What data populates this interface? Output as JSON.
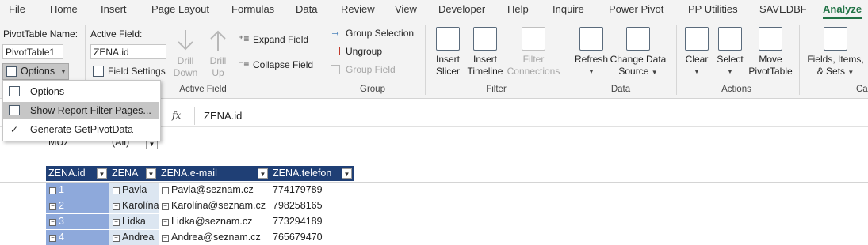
{
  "menu_tabs": [
    "File",
    "Home",
    "Insert",
    "Page Layout",
    "Formulas",
    "Data",
    "Review",
    "View",
    "Developer",
    "Help",
    "Inquire",
    "Power Pivot",
    "PP Utilities",
    "SAVEDBF",
    "Analyze"
  ],
  "pivot": {
    "name_label": "PivotTable Name:",
    "name_value": "PivotTable1",
    "options_label": "Options",
    "active_field_label": "Active Field:",
    "active_field_value": "ZENA.id",
    "field_settings": "Field Settings",
    "drill_down": [
      "Drill",
      "Down"
    ],
    "drill_up": [
      "Drill",
      "Up"
    ],
    "expand_field": "Expand Field",
    "collapse_field": "Collapse Field",
    "active_field_group": "Active Field"
  },
  "group": {
    "group_selection": "Group Selection",
    "ungroup": "Ungroup",
    "group_field": "Group Field",
    "label": "Group"
  },
  "filter": {
    "insert_slicer": [
      "Insert",
      "Slicer"
    ],
    "insert_timeline": [
      "Insert",
      "Timeline"
    ],
    "filter_connections": [
      "Filter",
      "Connections"
    ],
    "label": "Filter"
  },
  "data_group": {
    "refresh": "Refresh",
    "change_source": [
      "Change Data",
      "Source"
    ],
    "label": "Data"
  },
  "actions": {
    "clear": "Clear",
    "select": "Select",
    "move": [
      "Move",
      "PivotTable"
    ],
    "label": "Actions"
  },
  "calc": {
    "fields": [
      "Fields, Items,",
      "& Sets"
    ],
    "label_partial": "Ca"
  },
  "options_menu": {
    "items": [
      "Options",
      "Show Report Filter Pages...",
      "Generate GetPivotData"
    ]
  },
  "formula_bar": {
    "fx": "fx",
    "content": "ZENA.id"
  },
  "filter_row": {
    "field": "MUZ",
    "value": "(All)"
  },
  "table": {
    "headers": [
      "ZENA.id",
      "ZENA",
      "ZENA.e-mail",
      "ZENA.telefon"
    ],
    "rows": [
      {
        "id": "1",
        "name": "Pavla",
        "email": "Pavla@seznam.cz",
        "phone": "774179789"
      },
      {
        "id": "2",
        "name": "Karolína",
        "email": "Karolína@seznam.cz",
        "phone": "798258165"
      },
      {
        "id": "3",
        "name": "Lidka",
        "email": "Lidka@seznam.cz",
        "phone": "773294189"
      },
      {
        "id": "4",
        "name": "Andrea",
        "email": "Andrea@seznam.cz",
        "phone": "765679470"
      }
    ]
  },
  "colors": {
    "accent": "#217346",
    "header_bg": "#1f3f75",
    "id_bg": "#8ea9db",
    "name_bg": "#dce6f1"
  }
}
